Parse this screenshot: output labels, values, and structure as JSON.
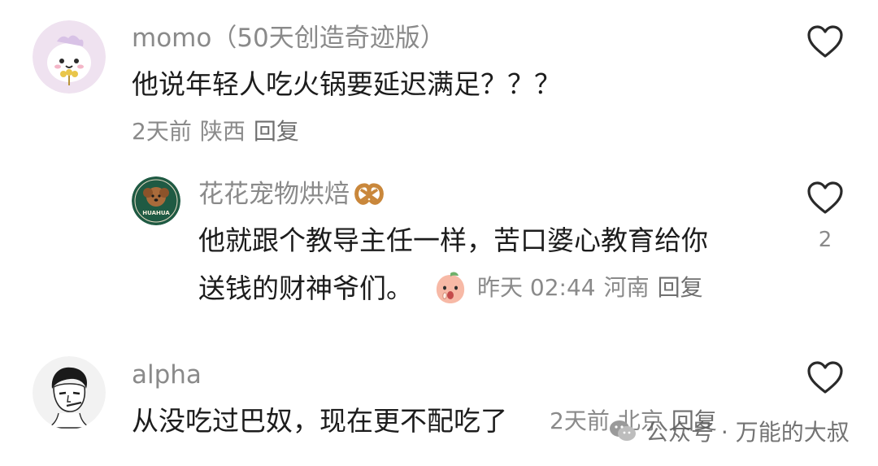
{
  "comments": [
    {
      "username": "momo（50天创造奇迹版）",
      "text": "他说年轻人吃火锅要延迟满足？？？",
      "time": "2天前",
      "location": "陕西",
      "reply_label": "回复"
    },
    {
      "username": "花花宠物烘焙",
      "text_line1": "他就跟个教导主任一样，苦口婆心教育给你",
      "text_line2": "送钱的财神爷们。",
      "time": "昨天 02:44",
      "location": "河南",
      "reply_label": "回复",
      "like_count": "2",
      "avatar_text": "HUAHUA"
    },
    {
      "username": "alpha",
      "text": "从没吃过巴奴，现在更不配吃了",
      "time": "2天前",
      "location": "北京",
      "reply_label": "回复"
    }
  ],
  "watermark": {
    "text": "公众号 · 万能的大叔"
  },
  "icons": {
    "like": "heart-outline-icon",
    "badge": "pretzel-icon",
    "sticker": "peach-emoji-icon",
    "watermark_logo": "wechat-icon"
  },
  "colors": {
    "text": "#1c1c1c",
    "muted": "#8a8a8a",
    "background": "#ffffff",
    "avatar_bg_1": "#efe2f0",
    "avatar_bg_2": "#1f5a43"
  }
}
